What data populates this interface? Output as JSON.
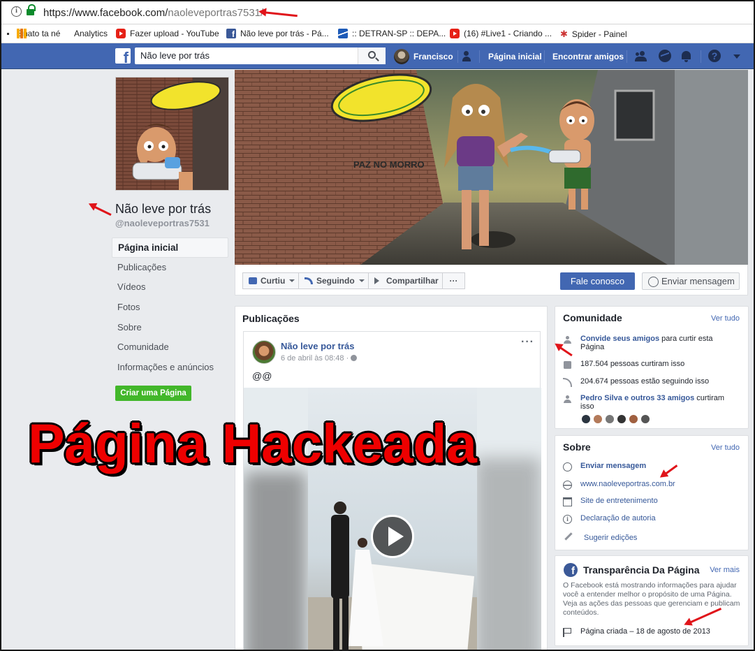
{
  "browser": {
    "url_prefix": "https://www.facebook.com/",
    "url_path": "naoleveportras7531/",
    "bookmarks": [
      {
        "label": "Enato ta né",
        "icon": "dot-icon"
      },
      {
        "label": "Analytics",
        "icon": "analytics-icon"
      },
      {
        "label": "Fazer upload - YouTube",
        "icon": "youtube-icon"
      },
      {
        "label": "Não leve por trás - Pá...",
        "icon": "facebook-icon"
      },
      {
        "label": ":: DETRAN-SP :: DEPA...",
        "icon": "detran-icon"
      },
      {
        "label": "(16) #Live1 - Criando ...",
        "icon": "youtube-icon"
      },
      {
        "label": "Spider - Painel",
        "icon": "spider-icon"
      }
    ]
  },
  "fb": {
    "search_value": "Não leve por trás",
    "user_name": "Francisco",
    "nav_home": "Página inicial",
    "nav_find_friends": "Encontrar amigos",
    "brand_color": "#4267b2"
  },
  "page": {
    "name": "Não leve por trás",
    "handle": "@naoleveportras7531",
    "left_nav": [
      "Página inicial",
      "Publicações",
      "Vídeos",
      "Fotos",
      "Sobre",
      "Comunidade",
      "Informações e anúncios"
    ],
    "create_page": "Criar uma Página"
  },
  "actions": {
    "liked": "Curtiu",
    "following": "Seguindo",
    "share": "Compartilhar",
    "more": "···",
    "contact": "Fale conosco",
    "send_message": "Enviar mensagem"
  },
  "posts": {
    "title": "Publicações",
    "post": {
      "author": "Não leve por trás",
      "date": "6 de abril às 08:48 · ",
      "text": "@@",
      "menu": "···"
    }
  },
  "community": {
    "title": "Comunidade",
    "see_all": "Ver tudo",
    "invite_link": "Convide seus amigos",
    "invite_rest": " para curtir esta Página",
    "likes": "187.504 pessoas curtiram isso",
    "follows": "204.674 pessoas estão seguindo isso",
    "friends_link": "Pedro Silva e outros 33 amigos",
    "friends_rest": " curtiram isso"
  },
  "about": {
    "title": "Sobre",
    "see_all": "Ver tudo",
    "send_message": "Enviar mensagem",
    "website": "www.naoleveportras.com.br",
    "category": "Site de entretenimento",
    "authorship": "Declaração de autoria",
    "suggest": "Sugerir edições"
  },
  "transparency": {
    "title": "Transparência Da Página",
    "see_more": "Ver mais",
    "description": "O Facebook está mostrando informações para ajudar você a entender melhor o propósito de uma Página. Veja as ações das pessoas que gerenciam e publicam conteúdos.",
    "created": "Página criada – 18 de agosto de 2013"
  },
  "overlay": {
    "caption": "Página Hackeada",
    "caption_color": "#ee0000"
  }
}
